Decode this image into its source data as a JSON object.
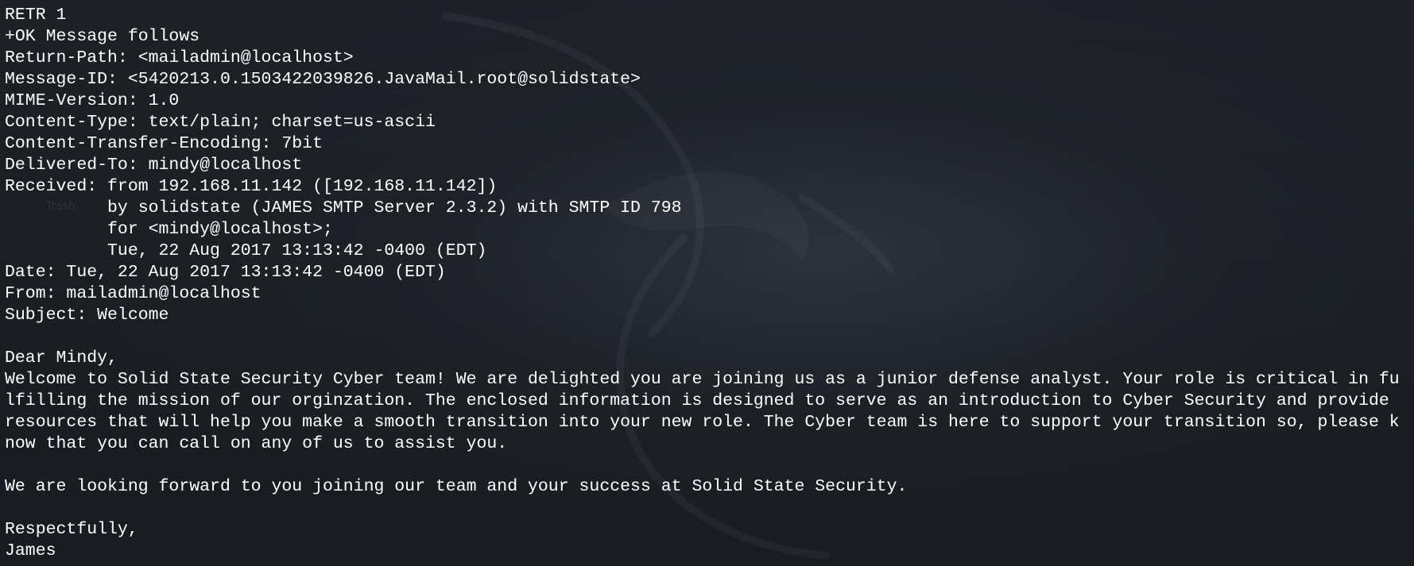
{
  "background": {
    "ghost_labels": [
      "Trash"
    ],
    "colors": {
      "bg": "#1a1d24",
      "text": "#ffffff"
    }
  },
  "terminal": {
    "lines": [
      "RETR 1",
      "+OK Message follows",
      "Return-Path: <mailadmin@localhost>",
      "Message-ID: <5420213.0.1503422039826.JavaMail.root@solidstate>",
      "MIME-Version: 1.0",
      "Content-Type: text/plain; charset=us-ascii",
      "Content-Transfer-Encoding: 7bit",
      "Delivered-To: mindy@localhost",
      "Received: from 192.168.11.142 ([192.168.11.142])",
      "          by solidstate (JAMES SMTP Server 2.3.2) with SMTP ID 798",
      "          for <mindy@localhost>;",
      "          Tue, 22 Aug 2017 13:13:42 -0400 (EDT)",
      "Date: Tue, 22 Aug 2017 13:13:42 -0400 (EDT)",
      "From: mailadmin@localhost",
      "Subject: Welcome",
      "",
      "Dear Mindy,",
      "Welcome to Solid State Security Cyber team! We are delighted you are joining us as a junior defense analyst. Your role is critical in fu",
      "lfilling the mission of our orginzation. The enclosed information is designed to serve as an introduction to Cyber Security and provide",
      "resources that will help you make a smooth transition into your new role. The Cyber team is here to support your transition so, please k",
      "now that you can call on any of us to assist you.",
      "",
      "We are looking forward to you joining our team and your success at Solid State Security.",
      "",
      "Respectfully,",
      "James"
    ]
  }
}
